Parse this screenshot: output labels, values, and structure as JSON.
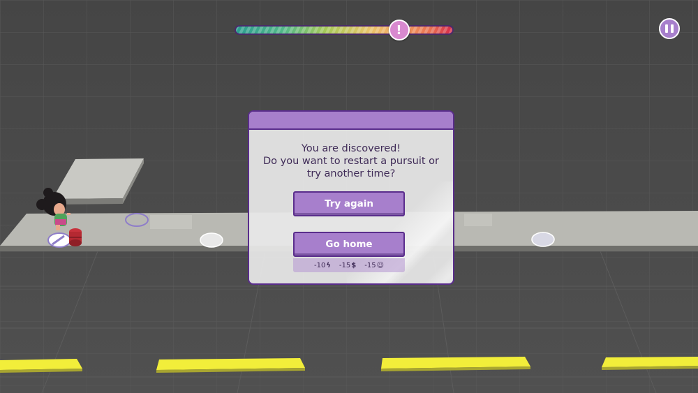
{
  "hud": {
    "alert_meter": {
      "level": 0.75,
      "icon": "exclamation-icon",
      "knob_symbol": "!"
    },
    "pause": {
      "icon": "pause-icon"
    }
  },
  "dialog": {
    "message_lines": [
      "You are discovered!",
      "Do you want to restart a pursuit or",
      "try another time?"
    ],
    "try_again_label": "Try again",
    "go_home_label": "Go home",
    "costs": [
      {
        "amount": "-10",
        "icon": "lightning-icon",
        "symbol": "ϟ"
      },
      {
        "amount": "-15",
        "icon": "dollar-icon",
        "symbol": "$"
      },
      {
        "amount": "-15",
        "icon": "smiley-icon",
        "symbol": "☺"
      }
    ]
  },
  "colors": {
    "accent": "#a77fcc",
    "accent_dark": "#5a2d8c",
    "text": "#3f2b57",
    "road_mark": "#f2ee3a"
  }
}
